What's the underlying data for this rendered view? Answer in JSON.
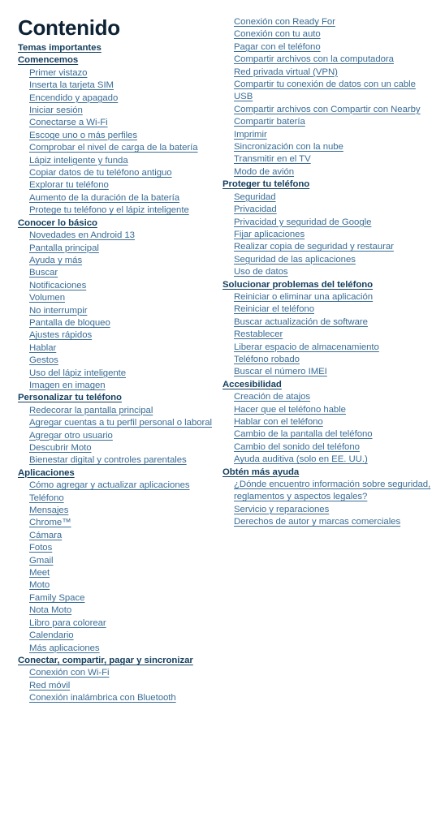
{
  "document": {
    "title": "Contenido",
    "language": "es",
    "colors": {
      "title": "#0d2235",
      "section_header": "#143f5e",
      "link": "#3a6d96",
      "background": "#ffffff"
    }
  },
  "columns": [
    {
      "name": "left-column",
      "entries": [
        {
          "type": "section",
          "label": "Temas importantes"
        },
        {
          "type": "section",
          "label": "Comencemos"
        },
        {
          "type": "item",
          "label": "Primer vistazo"
        },
        {
          "type": "item",
          "label": "Inserta la tarjeta SIM"
        },
        {
          "type": "item",
          "label": "Encendido y apagado"
        },
        {
          "type": "item",
          "label": "Iniciar sesión"
        },
        {
          "type": "item",
          "label": "Conectarse a Wi-Fi"
        },
        {
          "type": "item",
          "label": "Escoge uno o más perfiles"
        },
        {
          "type": "item",
          "label": "Comprobar el nivel de carga de la batería"
        },
        {
          "type": "item",
          "label": "Lápiz inteligente y funda"
        },
        {
          "type": "item",
          "label": "Copiar datos de tu teléfono antiguo"
        },
        {
          "type": "item",
          "label": "Explorar tu teléfono"
        },
        {
          "type": "item",
          "label": "Aumento de la duración de la batería"
        },
        {
          "type": "item",
          "label": "Protege tu teléfono y el lápiz inteligente"
        },
        {
          "type": "section",
          "label": "Conocer lo básico"
        },
        {
          "type": "item",
          "label": "Novedades en Android 13"
        },
        {
          "type": "item",
          "label": "Pantalla principal"
        },
        {
          "type": "item",
          "label": "Ayuda y más"
        },
        {
          "type": "item",
          "label": "Buscar"
        },
        {
          "type": "item",
          "label": "Notificaciones"
        },
        {
          "type": "item",
          "label": "Volumen"
        },
        {
          "type": "item",
          "label": "No interrumpir"
        },
        {
          "type": "item",
          "label": "Pantalla de bloqueo"
        },
        {
          "type": "item",
          "label": "Ajustes rápidos"
        },
        {
          "type": "item",
          "label": "Hablar"
        },
        {
          "type": "item",
          "label": "Gestos"
        },
        {
          "type": "item",
          "label": "Uso del lápiz inteligente"
        },
        {
          "type": "item",
          "label": "Imagen en imagen"
        },
        {
          "type": "section",
          "label": "Personalizar tu teléfono"
        },
        {
          "type": "item",
          "label": "Redecorar la pantalla principal"
        },
        {
          "type": "item",
          "label": "Agregar cuentas a tu perfil personal o laboral "
        },
        {
          "type": "item",
          "label": "Agregar otro usuario"
        },
        {
          "type": "item",
          "label": "Descubrir Moto"
        },
        {
          "type": "item",
          "label": "Bienestar digital y controles parentales"
        },
        {
          "type": "section",
          "label": "Aplicaciones"
        },
        {
          "type": "item",
          "label": "Cómo agregar y actualizar aplicaciones"
        },
        {
          "type": "item",
          "label": "Teléfono"
        },
        {
          "type": "item",
          "label": "Mensajes"
        },
        {
          "type": "item",
          "label": "Chrome™"
        },
        {
          "type": "item",
          "label": "Cámara"
        },
        {
          "type": "item",
          "label": "Fotos"
        },
        {
          "type": "item",
          "label": "Gmail"
        },
        {
          "type": "item",
          "label": "Meet"
        },
        {
          "type": "item",
          "label": "Moto"
        },
        {
          "type": "item",
          "label": "Family Space"
        },
        {
          "type": "item",
          "label": "Nota Moto"
        },
        {
          "type": "item",
          "label": "Libro para colorear"
        },
        {
          "type": "item",
          "label": "Calendario"
        },
        {
          "type": "item",
          "label": "Más aplicaciones"
        },
        {
          "type": "section",
          "label": "Conectar, compartir, pagar y sincronizar"
        },
        {
          "type": "item",
          "label": "Conexión con Wi-Fi"
        },
        {
          "type": "item",
          "label": "Red móvil"
        },
        {
          "type": "item",
          "label": "Conexión inalámbrica con Bluetooth"
        }
      ]
    },
    {
      "name": "right-column",
      "entries": [
        {
          "type": "item",
          "label": "Conexión con Ready For"
        },
        {
          "type": "item",
          "label": "Conexión con tu auto"
        },
        {
          "type": "item",
          "label": "Pagar con el teléfono"
        },
        {
          "type": "item",
          "label": "Compartir archivos con la computadora"
        },
        {
          "type": "item",
          "label": "Red privada virtual (VPN)"
        },
        {
          "type": "item",
          "label": "Compartir tu conexión de datos con un cable USB"
        },
        {
          "type": "item",
          "label": "Compartir archivos con Compartir con Nearby"
        },
        {
          "type": "item",
          "label": "Compartir batería"
        },
        {
          "type": "item",
          "label": "Imprimir"
        },
        {
          "type": "item",
          "label": "Sincronización con la nube"
        },
        {
          "type": "item",
          "label": "Transmitir en el TV"
        },
        {
          "type": "item",
          "label": "Modo de avión"
        },
        {
          "type": "section",
          "label": "Proteger tu teléfono"
        },
        {
          "type": "item",
          "label": "Seguridad"
        },
        {
          "type": "item",
          "label": "Privacidad"
        },
        {
          "type": "item",
          "label": "Privacidad y seguridad de Google"
        },
        {
          "type": "item",
          "label": "Fijar aplicaciones"
        },
        {
          "type": "item",
          "label": "Realizar copia de seguridad y restaurar"
        },
        {
          "type": "item",
          "label": "Seguridad de las aplicaciones"
        },
        {
          "type": "item",
          "label": "Uso de datos"
        },
        {
          "type": "section",
          "label": "Solucionar problemas del teléfono"
        },
        {
          "type": "item",
          "label": "Reiniciar o eliminar una aplicación"
        },
        {
          "type": "item",
          "label": "Reiniciar el teléfono"
        },
        {
          "type": "item",
          "label": "Buscar actualización de software"
        },
        {
          "type": "item",
          "label": "Restablecer"
        },
        {
          "type": "item",
          "label": "Liberar espacio de almacenamiento"
        },
        {
          "type": "item",
          "label": "Teléfono robado"
        },
        {
          "type": "item",
          "label": "Buscar el número IMEI"
        },
        {
          "type": "section",
          "label": "Accesibilidad"
        },
        {
          "type": "item",
          "label": "Creación de atajos"
        },
        {
          "type": "item",
          "label": "Hacer que el teléfono hable"
        },
        {
          "type": "item",
          "label": "Hablar con el teléfono"
        },
        {
          "type": "item",
          "label": "Cambio de la pantalla del teléfono"
        },
        {
          "type": "item",
          "label": "Cambio del sonido del teléfono"
        },
        {
          "type": "item",
          "label": "Ayuda auditiva (solo en EE. UU.)"
        },
        {
          "type": "section",
          "label": "Obtén más ayuda"
        },
        {
          "type": "item",
          "label": "¿Dónde encuentro información sobre seguridad, reglamentos y aspectos legales?"
        },
        {
          "type": "item",
          "label": "Servicio y reparaciones"
        },
        {
          "type": "item",
          "label": "Derechos de autor y marcas comerciales"
        }
      ]
    }
  ]
}
